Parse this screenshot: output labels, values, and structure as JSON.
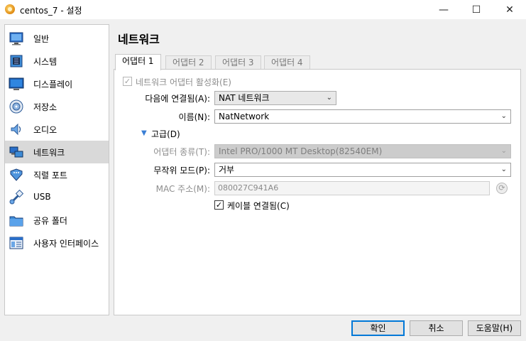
{
  "window": {
    "title": "centos_7 - 설정",
    "minimize": "—",
    "maximize": "☐",
    "close": "✕"
  },
  "sidebar": {
    "items": [
      {
        "label": "일반",
        "icon": "general-icon"
      },
      {
        "label": "시스템",
        "icon": "system-icon"
      },
      {
        "label": "디스플레이",
        "icon": "display-icon"
      },
      {
        "label": "저장소",
        "icon": "storage-icon"
      },
      {
        "label": "오디오",
        "icon": "audio-icon"
      },
      {
        "label": "네트워크",
        "icon": "network-icon",
        "selected": true
      },
      {
        "label": "직렬 포트",
        "icon": "serial-port-icon"
      },
      {
        "label": "USB",
        "icon": "usb-icon"
      },
      {
        "label": "공유 폴더",
        "icon": "shared-folder-icon"
      },
      {
        "label": "사용자 인터페이스",
        "icon": "user-interface-icon"
      }
    ]
  },
  "main": {
    "title": "네트워크",
    "tabs": [
      "어댑터 1",
      "어댑터 2",
      "어댑터 3",
      "어댑터 4"
    ],
    "active_tab": 0,
    "enable_adapter": {
      "label": "네트워크 어댑터 활성화(E)",
      "checked": true,
      "disabled": true
    },
    "attached_to": {
      "label": "다음에 연결됨(A):",
      "value": "NAT 네트워크"
    },
    "name": {
      "label": "이름(N):",
      "value": "NatNetwork"
    },
    "advanced": {
      "label": "고급(D)",
      "expanded": true
    },
    "adapter_type": {
      "label": "어댑터 종류(T):",
      "value": "Intel PRO/1000 MT Desktop(82540EM)",
      "disabled": true
    },
    "promiscuous": {
      "label": "무작위 모드(P):",
      "value": "거부"
    },
    "mac": {
      "label": "MAC 주소(M):",
      "value": "080027C941A6",
      "disabled": true
    },
    "cable": {
      "label": "케이블 연결됨(C)",
      "checked": true
    }
  },
  "footer": {
    "ok": "확인",
    "cancel": "취소",
    "help": "도움말(H)"
  },
  "colors": {
    "accent": "#0078d7",
    "selected_bg": "#d9d9d9",
    "advanced_triangle": "#3a7fd5"
  }
}
